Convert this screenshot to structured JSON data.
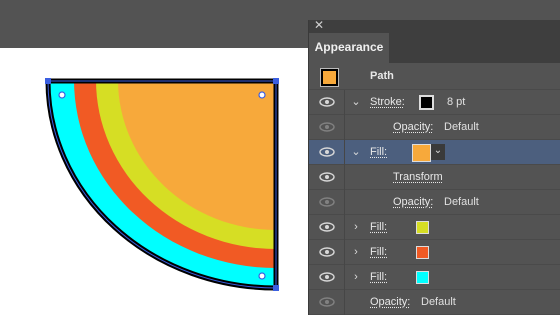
{
  "panel": {
    "title": "Appearance",
    "header_label": "Path",
    "rows": [
      {
        "label": "Stroke:",
        "value": "8 pt"
      },
      {
        "label": "Opacity:",
        "value": "Default"
      },
      {
        "label": "Fill:"
      },
      {
        "label": "Transform"
      },
      {
        "label": "Opacity:",
        "value": "Default"
      },
      {
        "label": "Fill:"
      },
      {
        "label": "Fill:"
      },
      {
        "label": "Fill:"
      },
      {
        "label": "Opacity:",
        "value": "Default"
      }
    ]
  },
  "colors": {
    "orange_fill": "#f7a93b",
    "yellow_fill": "#d6de24",
    "red_fill": "#f15a24",
    "cyan_fill": "#00ffff",
    "stroke": "#000000",
    "selection": "#4c5f7e",
    "handle": "#3b5fe0"
  },
  "icons": {
    "close": "close-icon",
    "eye": "eye-icon",
    "chevron_down": "chevron-down-icon",
    "chevron_right": "chevron-right-icon"
  }
}
